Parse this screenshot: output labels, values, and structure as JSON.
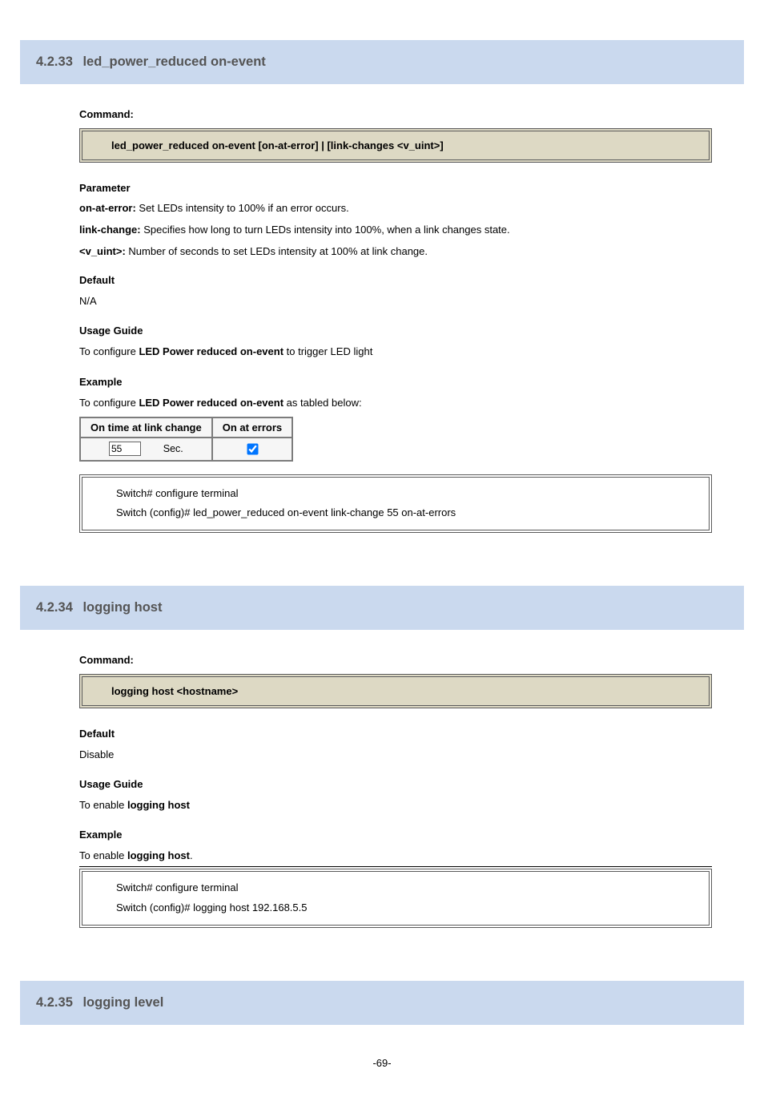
{
  "section1": {
    "number": "4.2.33",
    "title": "led_power_reduced on-event",
    "code": "led_power_reduced on-event [on-at-error] | [link-changes <v_uint>]",
    "params_heading": "Parameter",
    "params": [
      {
        "label": "on-at-error:",
        "text": " Set LEDs intensity to 100% if an error occurs."
      },
      {
        "label": "link-change:",
        "text": " Specifies how long to turn LEDs intensity into 100%, when a link changes state."
      },
      {
        "label": "<v_uint>:",
        "text": " Number of seconds to set LEDs intensity at 100% at link change."
      }
    ],
    "default_heading": "Default",
    "default_text": "N/A",
    "usage_heading": "Usage Guide",
    "usage_prefix": "To configure ",
    "usage_bold": "LED Power reduced on-event",
    "usage_suffix": " to trigger LED light",
    "example_heading": "Example",
    "example_prefix": "To configure ",
    "example_bold": "LED Power reduced on-event",
    "example_suffix": " as tabled below:",
    "gui_table": {
      "h1": "On time at link change",
      "h2": "On at errors",
      "value": "55",
      "unit": "Sec.",
      "checked": true
    },
    "example_lines": [
      "Switch# configure terminal",
      "Switch (config)# led_power_reduced on-event link-change 55 on-at-errors"
    ]
  },
  "section2": {
    "number": "4.2.34",
    "title": "logging host",
    "code": "logging host <hostname>",
    "default_heading": "Default",
    "default_text": "Disable",
    "usage_heading": "Usage Guide",
    "usage_prefix": "To enable ",
    "usage_bold": "logging host",
    "example_heading": "Example",
    "example_prefix": "To enable ",
    "example_bold": "logging host",
    "example_suffix": ".",
    "example_lines": [
      "Switch# configure terminal",
      "Switch (config)# logging host 192.168.5.5"
    ]
  },
  "section3": {
    "number": "4.2.35",
    "title": "logging level"
  },
  "footer": "-69-"
}
